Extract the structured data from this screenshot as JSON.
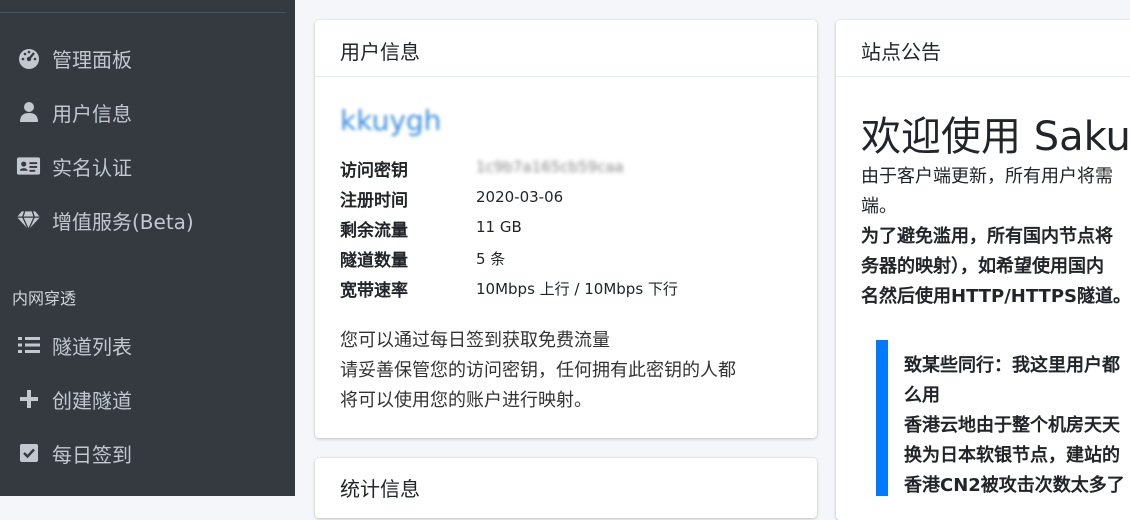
{
  "sidebar": {
    "items": [
      {
        "label": "管理面板",
        "icon": "tachometer-icon"
      },
      {
        "label": "用户信息",
        "icon": "user-icon"
      },
      {
        "label": "实名认证",
        "icon": "id-card-icon"
      },
      {
        "label": "增值服务(Beta)",
        "icon": "gem-icon"
      }
    ],
    "section_header": "内网穿透",
    "section_items": [
      {
        "label": "隧道列表",
        "icon": "list-icon"
      },
      {
        "label": "创建隧道",
        "icon": "plus-icon"
      },
      {
        "label": "每日签到",
        "icon": "check-square-icon"
      }
    ]
  },
  "user_info": {
    "title": "用户信息",
    "username": "kkuygh",
    "rows": [
      {
        "key": "访问密钥",
        "value": "1c9b7a165cb59caa",
        "masked": true
      },
      {
        "key": "注册时间",
        "value": "2020-03-06"
      },
      {
        "key": "剩余流量",
        "value": "11 GB"
      },
      {
        "key": "隧道数量",
        "value": "5 条"
      },
      {
        "key": "宽带速率",
        "value": "10Mbps 上行 / 10Mbps 下行"
      }
    ],
    "notes": [
      "您可以通过每日签到获取免费流量",
      "请妥善保管您的访问密钥，任何拥有此密钥的人都",
      "将可以使用您的账户进行映射。"
    ]
  },
  "stats": {
    "title": "统计信息"
  },
  "announcement": {
    "title": "站点公告",
    "headline": "欢迎使用 Sakura",
    "lines": [
      {
        "text": "由于客户端更新，所有用户将需",
        "bold": false
      },
      {
        "text": "端。",
        "bold": false
      },
      {
        "text": "为了避免滥用，所有国内节点将",
        "bold": true
      },
      {
        "text": "务器的映射），如希望使用国内",
        "bold": true
      },
      {
        "text": "名然后使用HTTP/HTTPS隧道。",
        "bold": true
      }
    ],
    "quote_lines": [
      "致某些同行：我这里用户都",
      "么用",
      "香港云地由于整个机房天天",
      "换为日本软银节点，建站的",
      "香港CN2被攻击次数太多了"
    ]
  },
  "colors": {
    "sidebar_bg": "#343a40",
    "accent": "#007bff",
    "username_link": "#3a8ee6",
    "page_bg": "#f4f6f9"
  }
}
